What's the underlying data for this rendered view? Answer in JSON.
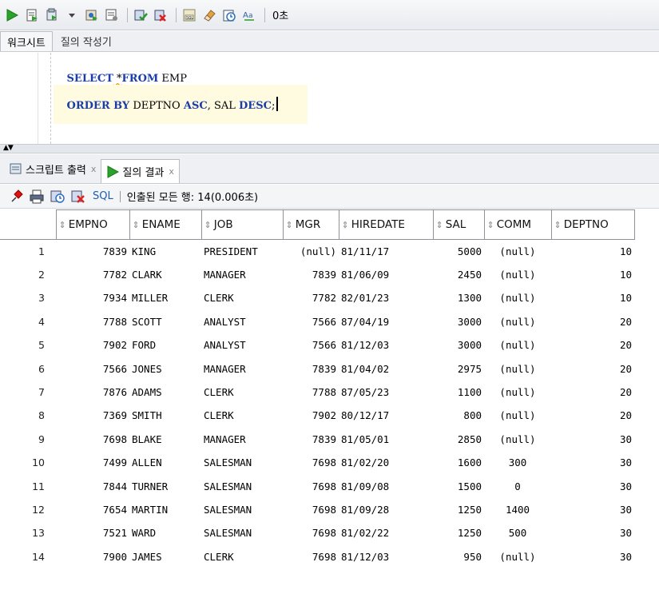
{
  "toolbar": {
    "buttons": [
      "run-statement",
      "run-script",
      "autotrace",
      "explain-plan",
      "sql-tuning-advisor",
      "commit",
      "rollback",
      "unshared-sql",
      "clear",
      "history",
      "format"
    ],
    "elapsed": "0초"
  },
  "editor_tabs": {
    "worksheet": "워크시트",
    "query_builder": "질의 작성기"
  },
  "editor": {
    "line1": {
      "kw1": "SELECT",
      "star": " *",
      "kw2": "FROM",
      "rest": " EMP"
    },
    "line2": {
      "kw1": "ORDER BY",
      "mid": " DEPTNO ",
      "kw2": "ASC",
      "mid2": ", SAL ",
      "kw3": "DESC",
      "end": ";"
    }
  },
  "result_tabs": {
    "script_output": "스크립트 출력",
    "query_result": "질의 결과",
    "close": "x"
  },
  "result_toolbar": {
    "sql_label": "SQL",
    "status": "인출된 모든 행: 14(0.006초)"
  },
  "grid": {
    "columns": [
      "EMPNO",
      "ENAME",
      "JOB",
      "MGR",
      "HIREDATE",
      "SAL",
      "COMM",
      "DEPTNO"
    ],
    "rows": [
      [
        "1",
        "7839",
        "KING",
        "PRESIDENT",
        "(null)",
        "81/11/17",
        "5000",
        "(null)",
        "10"
      ],
      [
        "2",
        "7782",
        "CLARK",
        "MANAGER",
        "7839",
        "81/06/09",
        "2450",
        "(null)",
        "10"
      ],
      [
        "3",
        "7934",
        "MILLER",
        "CLERK",
        "7782",
        "82/01/23",
        "1300",
        "(null)",
        "10"
      ],
      [
        "4",
        "7788",
        "SCOTT",
        "ANALYST",
        "7566",
        "87/04/19",
        "3000",
        "(null)",
        "20"
      ],
      [
        "5",
        "7902",
        "FORD",
        "ANALYST",
        "7566",
        "81/12/03",
        "3000",
        "(null)",
        "20"
      ],
      [
        "6",
        "7566",
        "JONES",
        "MANAGER",
        "7839",
        "81/04/02",
        "2975",
        "(null)",
        "20"
      ],
      [
        "7",
        "7876",
        "ADAMS",
        "CLERK",
        "7788",
        "87/05/23",
        "1100",
        "(null)",
        "20"
      ],
      [
        "8",
        "7369",
        "SMITH",
        "CLERK",
        "7902",
        "80/12/17",
        "800",
        "(null)",
        "20"
      ],
      [
        "9",
        "7698",
        "BLAKE",
        "MANAGER",
        "7839",
        "81/05/01",
        "2850",
        "(null)",
        "30"
      ],
      [
        "10",
        "7499",
        "ALLEN",
        "SALESMAN",
        "7698",
        "81/02/20",
        "1600",
        "300",
        "30"
      ],
      [
        "11",
        "7844",
        "TURNER",
        "SALESMAN",
        "7698",
        "81/09/08",
        "1500",
        "0",
        "30"
      ],
      [
        "12",
        "7654",
        "MARTIN",
        "SALESMAN",
        "7698",
        "81/09/28",
        "1250",
        "1400",
        "30"
      ],
      [
        "13",
        "7521",
        "WARD",
        "SALESMAN",
        "7698",
        "81/02/22",
        "1250",
        "500",
        "30"
      ],
      [
        "14",
        "7900",
        "JAMES",
        "CLERK",
        "7698",
        "81/12/03",
        "950",
        "(null)",
        "30"
      ]
    ]
  }
}
